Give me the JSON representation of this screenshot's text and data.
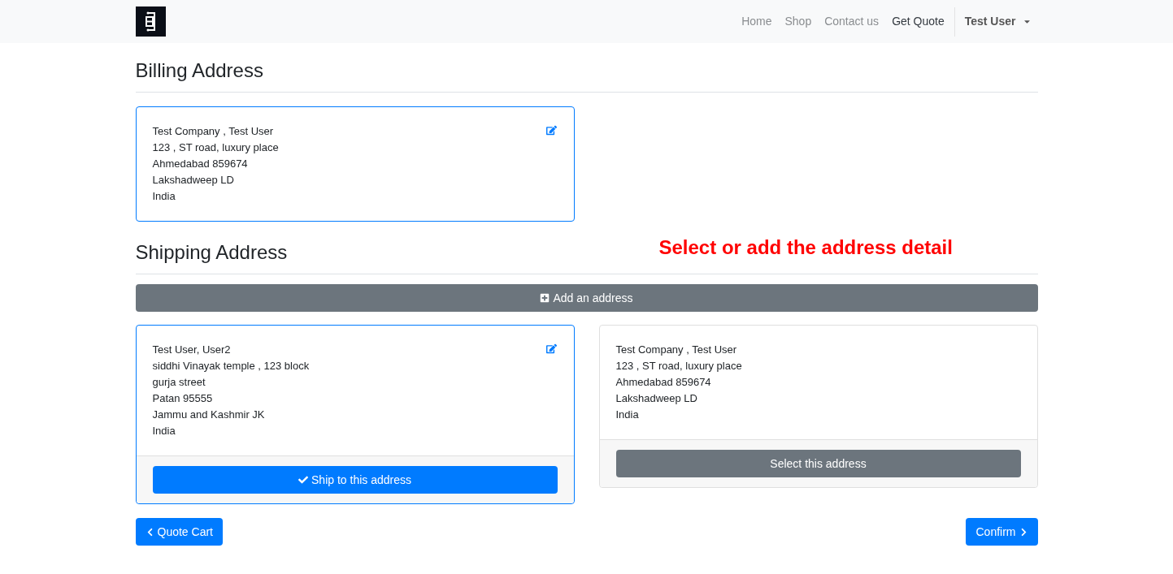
{
  "nav": {
    "items": [
      {
        "label": "Home",
        "selected": false
      },
      {
        "label": "Shop",
        "selected": false
      },
      {
        "label": "Contact us",
        "selected": false
      },
      {
        "label": "Get Quote",
        "selected": true
      }
    ],
    "user_menu": "Test User"
  },
  "billing": {
    "title": "Billing Address",
    "address": {
      "lines": [
        "Test Company , Test User",
        "123 , ST road, luxury place",
        "Ahmedabad 859674",
        "Lakshadweep LD",
        "India"
      ],
      "editable": true,
      "selected": true
    }
  },
  "shipping": {
    "title": "Shipping Address",
    "annotation": "Select or add the address detail",
    "add_button": "Add an address",
    "addresses": [
      {
        "lines": [
          "Test User, User2",
          "siddhi Vinayak temple , 123 block",
          "gurja street",
          "Patan 95555",
          "Jammu and Kashmir JK",
          "India"
        ],
        "editable": true,
        "selected": true,
        "action": "Ship to this address"
      },
      {
        "lines": [
          "Test Company , Test User",
          "123 , ST road, luxury place",
          "Ahmedabad 859674",
          "Lakshadweep LD",
          "India"
        ],
        "editable": false,
        "selected": false,
        "action": "Select this address"
      }
    ]
  },
  "footer": {
    "back": "Quote Cart",
    "next": "Confirm"
  }
}
